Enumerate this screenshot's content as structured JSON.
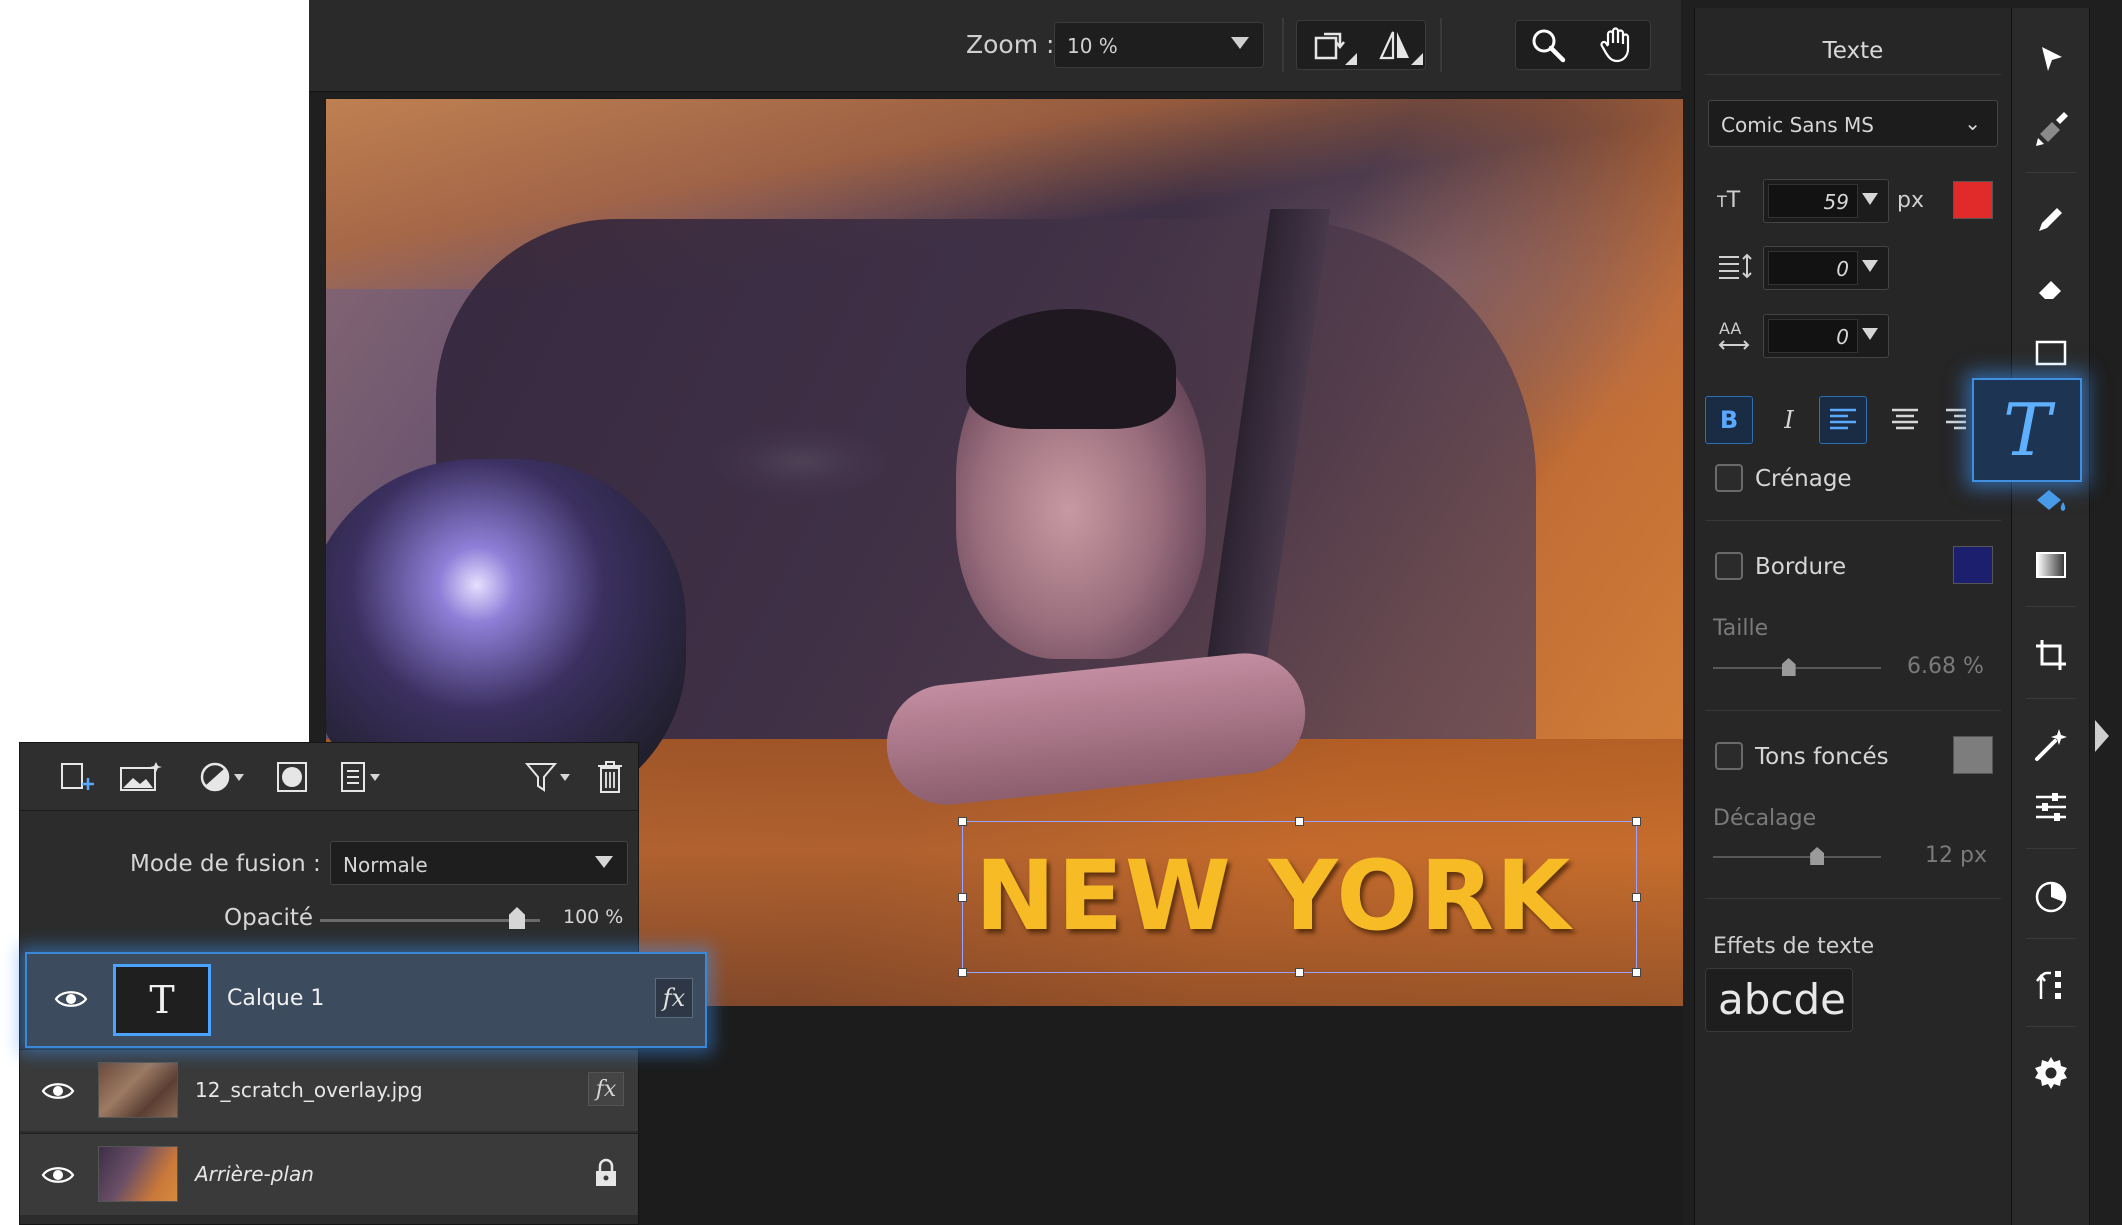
{
  "toolbar": {
    "zoom_label": "Zoom :",
    "zoom_value": "10 %",
    "tools": [
      {
        "icon": "rotate-icon"
      },
      {
        "icon": "flip-icon"
      },
      {
        "icon": "zoom-tool-icon"
      },
      {
        "icon": "pan-hand-icon"
      }
    ]
  },
  "canvas": {
    "overlay_text": "NEW YORK",
    "text_color": "#f7bb26"
  },
  "text_panel": {
    "title": "Texte",
    "font": "Comic Sans MS",
    "size": "59",
    "size_unit": "px",
    "text_color": "#e12b2b",
    "line_spacing": "0",
    "char_spacing": "0",
    "format_buttons": [
      {
        "label": "B",
        "active": true
      },
      {
        "label": "I",
        "active": false
      }
    ],
    "align_active": "left",
    "kerning_label": "Crénage",
    "border_label": "Bordure",
    "border_color": "#1c1f6e",
    "size_label": "Taille",
    "size_value": "6.68 %",
    "size_slider_fraction": 0.45,
    "shadow_label": "Tons foncés",
    "shadow_color": "#7d7d7d",
    "offset_label": "Décalage",
    "offset_value": "12 px",
    "offset_slider_fraction": 0.62,
    "effects_label": "Effets de texte",
    "effects_sample": "abcde"
  },
  "tools_bar": [
    "pointer-icon",
    "brush-eraser-icon",
    "pencil-icon",
    "eraser-icon",
    "rectangle-icon",
    "text-tool-icon",
    "fill-icon",
    "gradient-icon",
    "crop-icon",
    "magic-wand-icon",
    "adjust-sliders-icon",
    "color-wheel-icon",
    "history-icon",
    "settings-icon"
  ],
  "layers": {
    "blend_label": "Mode de fusion :",
    "blend_mode": "Normale",
    "opacity_label": "Opacité",
    "opacity_value": "100 %",
    "opacity_fraction": 1.0,
    "items": [
      {
        "name": "Calque 1",
        "type": "text",
        "thumb_glyph": "T",
        "fx": "fx",
        "active": true
      },
      {
        "name": "12_scratch_overlay.jpg",
        "type": "image",
        "fx": "fx",
        "active": false
      },
      {
        "name": "Arrière-plan",
        "type": "image",
        "locked": true,
        "active": false
      }
    ]
  }
}
